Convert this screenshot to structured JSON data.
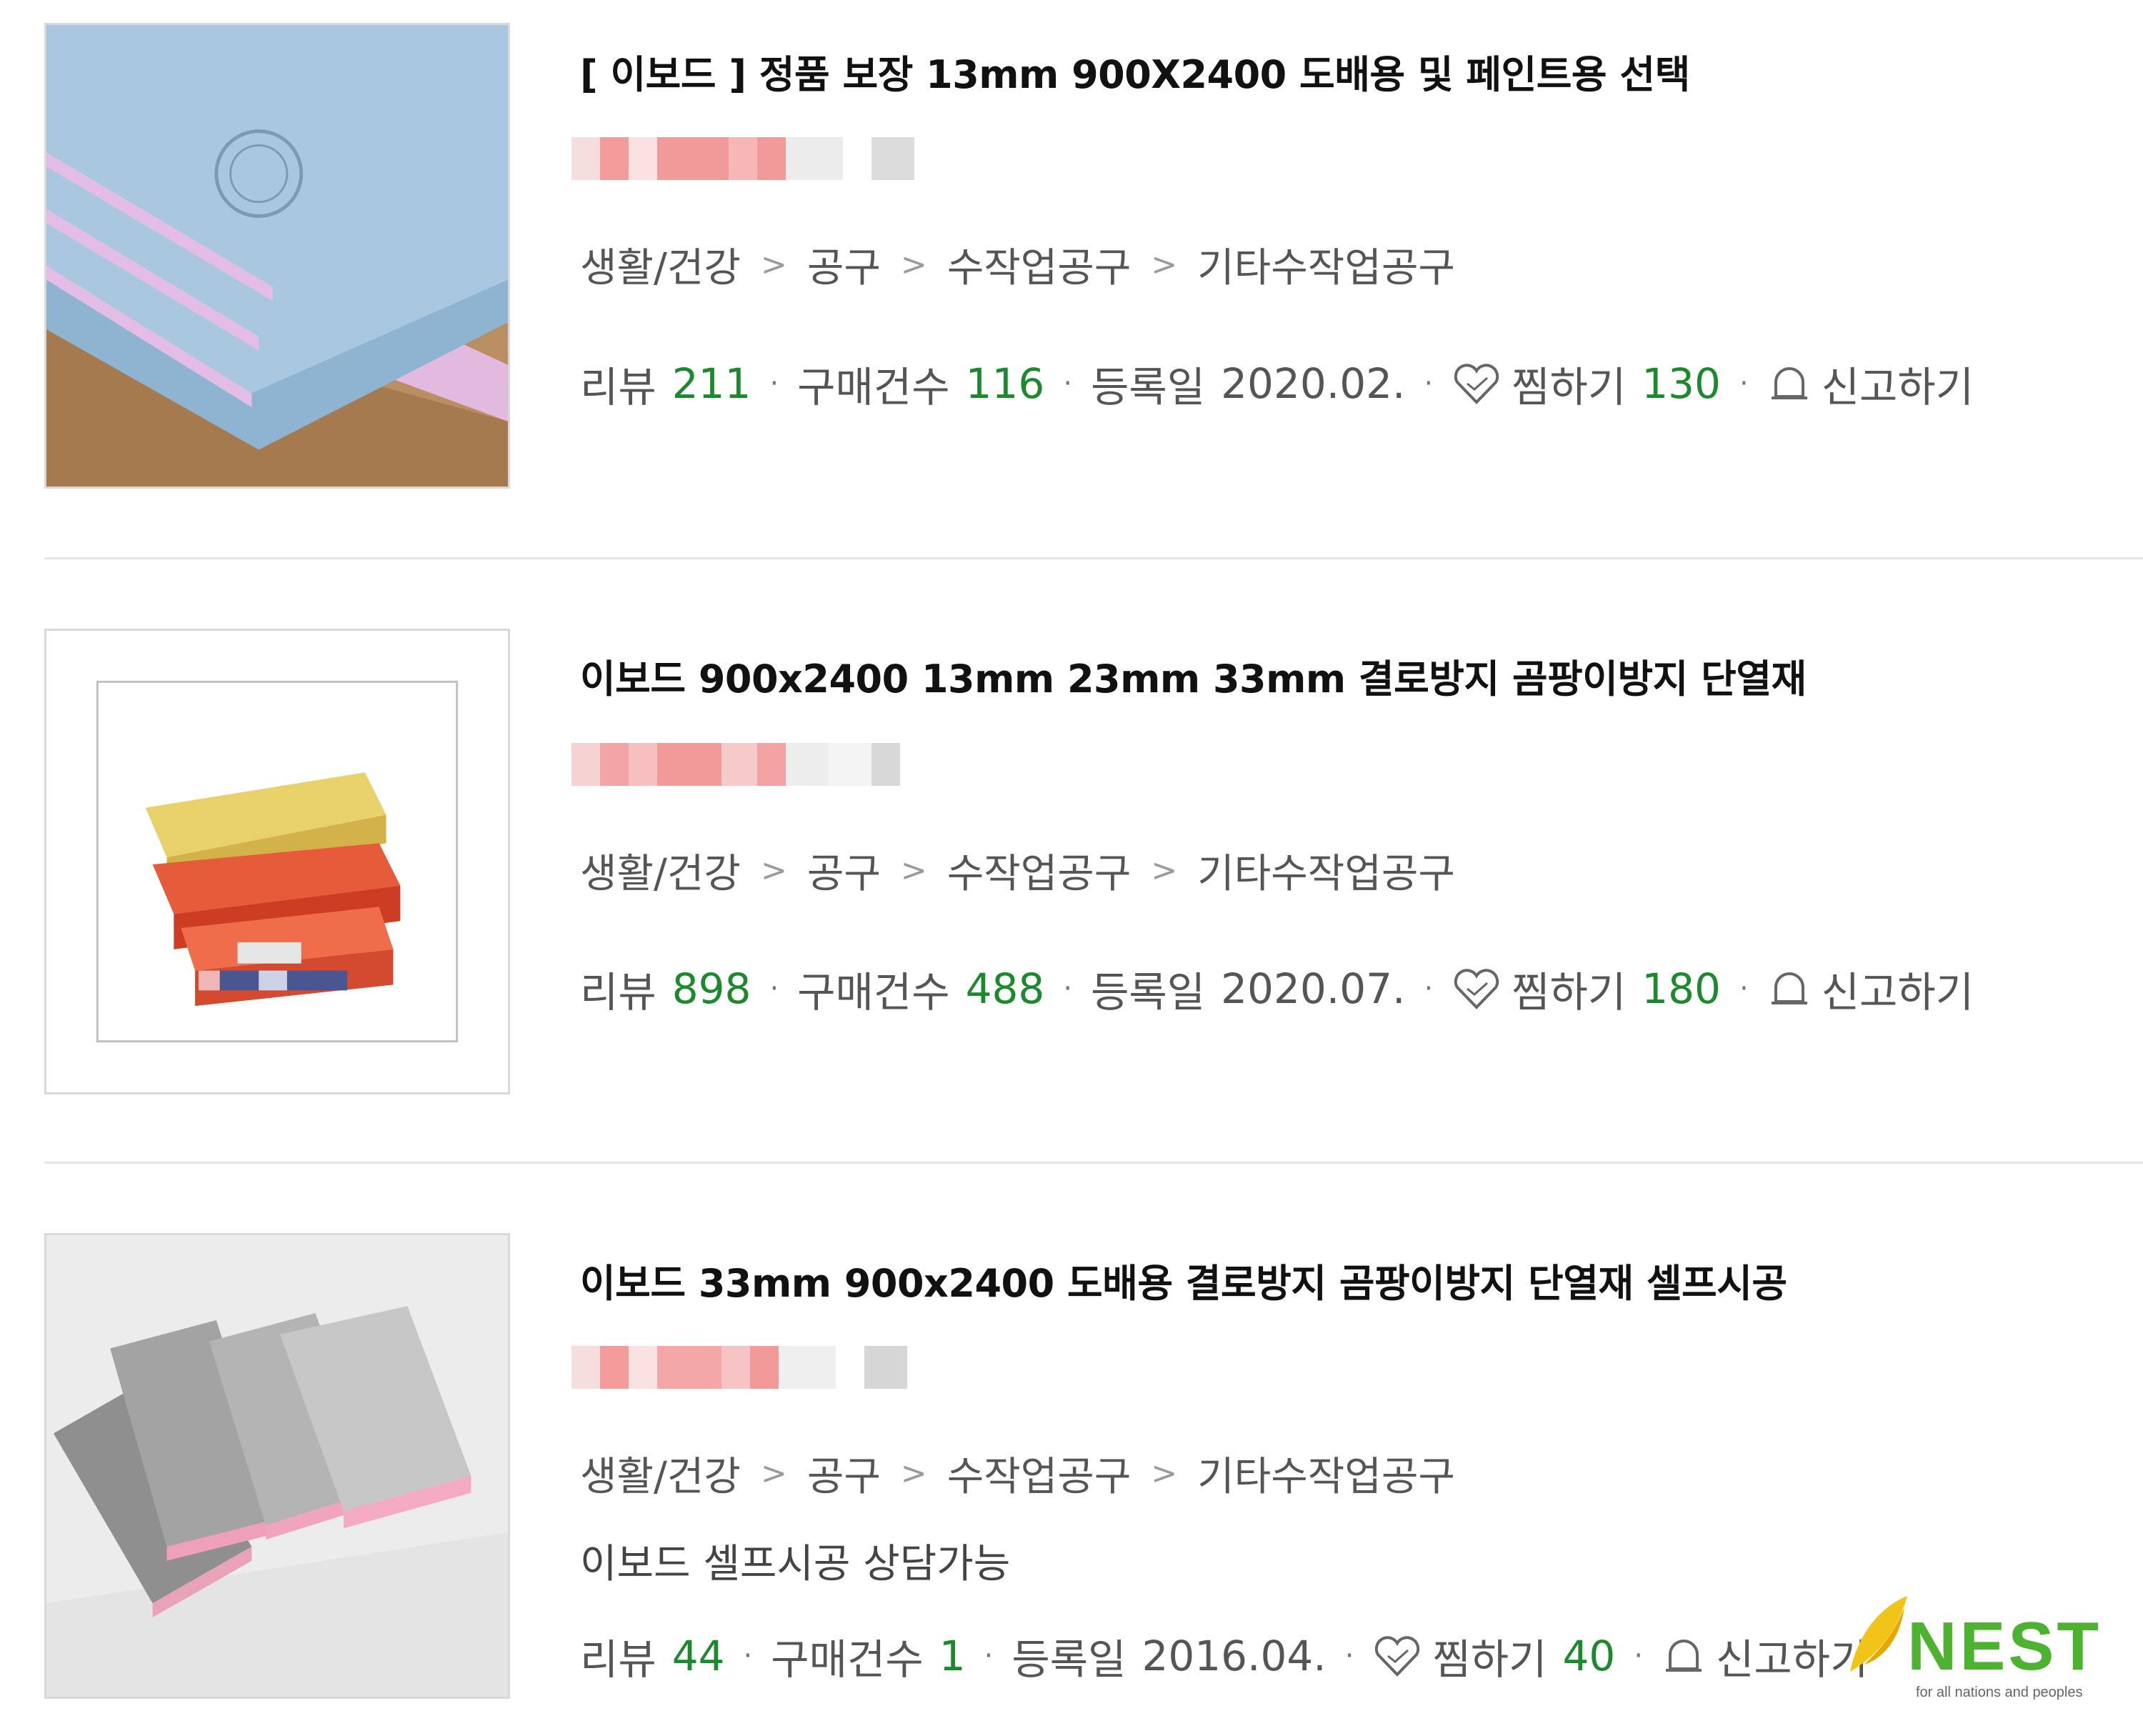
{
  "products": [
    {
      "title": "[ 이보드 ] 정품 보장 13mm 900X2400 도배용 및 페인트용 선택",
      "category": [
        "생활/건강",
        "공구",
        "수작업공구",
        "기타수작업공구"
      ],
      "description": "",
      "review_label": "리뷰",
      "review_count": "211",
      "purchase_label": "구매건수",
      "purchase_count": "116",
      "reg_label": "등록일",
      "reg_date": "2020.02.",
      "zzim_label": "찜하기",
      "zzim_count": "130",
      "report_label": "신고하기"
    },
    {
      "title": "이보드 900x2400 13mm 23mm 33mm 결로방지 곰팡이방지 단열재",
      "category": [
        "생활/건강",
        "공구",
        "수작업공구",
        "기타수작업공구"
      ],
      "description": "",
      "review_label": "리뷰",
      "review_count": "898",
      "purchase_label": "구매건수",
      "purchase_count": "488",
      "reg_label": "등록일",
      "reg_date": "2020.07.",
      "zzim_label": "찜하기",
      "zzim_count": "180",
      "report_label": "신고하기"
    },
    {
      "title": "이보드 33mm 900x2400 도배용 결로방지 곰팡이방지 단열재 셀프시공",
      "category": [
        "생활/건강",
        "공구",
        "수작업공구",
        "기타수작업공구"
      ],
      "description": "이보드 셀프시공 상담가능",
      "review_label": "리뷰",
      "review_count": "44",
      "purchase_label": "구매건수",
      "purchase_count": "1",
      "reg_label": "등록일",
      "reg_date": "2016.04.",
      "zzim_label": "찜하기",
      "zzim_count": "40",
      "report_label": "신고하기"
    }
  ],
  "category_separator": ">",
  "meta_separator": "·",
  "logo": {
    "name": "NEST",
    "tagline": "for all nations and peoples"
  },
  "colors": {
    "count_green": "#1a8a2c",
    "logo_green": "#4cb22f",
    "divider": "#e6e6e6"
  }
}
